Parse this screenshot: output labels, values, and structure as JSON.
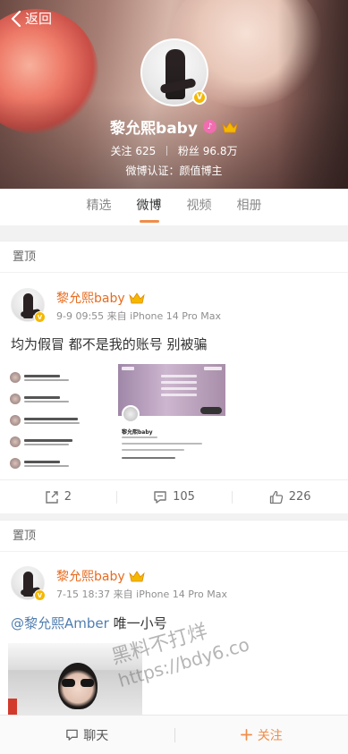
{
  "nav": {
    "back_label": "返回"
  },
  "profile": {
    "name": "黎允熙baby",
    "following_label": "关注",
    "following_count": "625",
    "followers_label": "粉丝",
    "followers_count": "96.8万",
    "verification": "微博认证：颜值博主",
    "avatar_badge": "V"
  },
  "tabs": [
    {
      "label": "精选",
      "active": false
    },
    {
      "label": "微博",
      "active": true
    },
    {
      "label": "视频",
      "active": false
    },
    {
      "label": "相册",
      "active": false
    }
  ],
  "posts": [
    {
      "pin_label": "置顶",
      "author": "黎允熙baby",
      "meta": "9-9 09:55  来自 iPhone 14 Pro Max",
      "text": "均为假冒 都不是我的账号 别被骗",
      "actions": {
        "repost": "2",
        "comment": "105",
        "like": "226"
      },
      "shot2": {
        "name": "黎允熙baby"
      }
    },
    {
      "pin_label": "置顶",
      "author": "黎允熙baby",
      "meta": "7-15 18:37  来自 iPhone 14 Pro Max",
      "mention": "@黎允熙Amber",
      "text_rest": " 唯一小号"
    }
  ],
  "watermark": {
    "line1": "黑料不打烊",
    "line2": "https://bdy6.co"
  },
  "bottom_bar": {
    "chat_label": "聊天",
    "follow_label": "关注"
  },
  "colors": {
    "accent": "#f08d49",
    "author": "#e86b1f",
    "mention": "#507daf",
    "verified": "#f5b800"
  }
}
